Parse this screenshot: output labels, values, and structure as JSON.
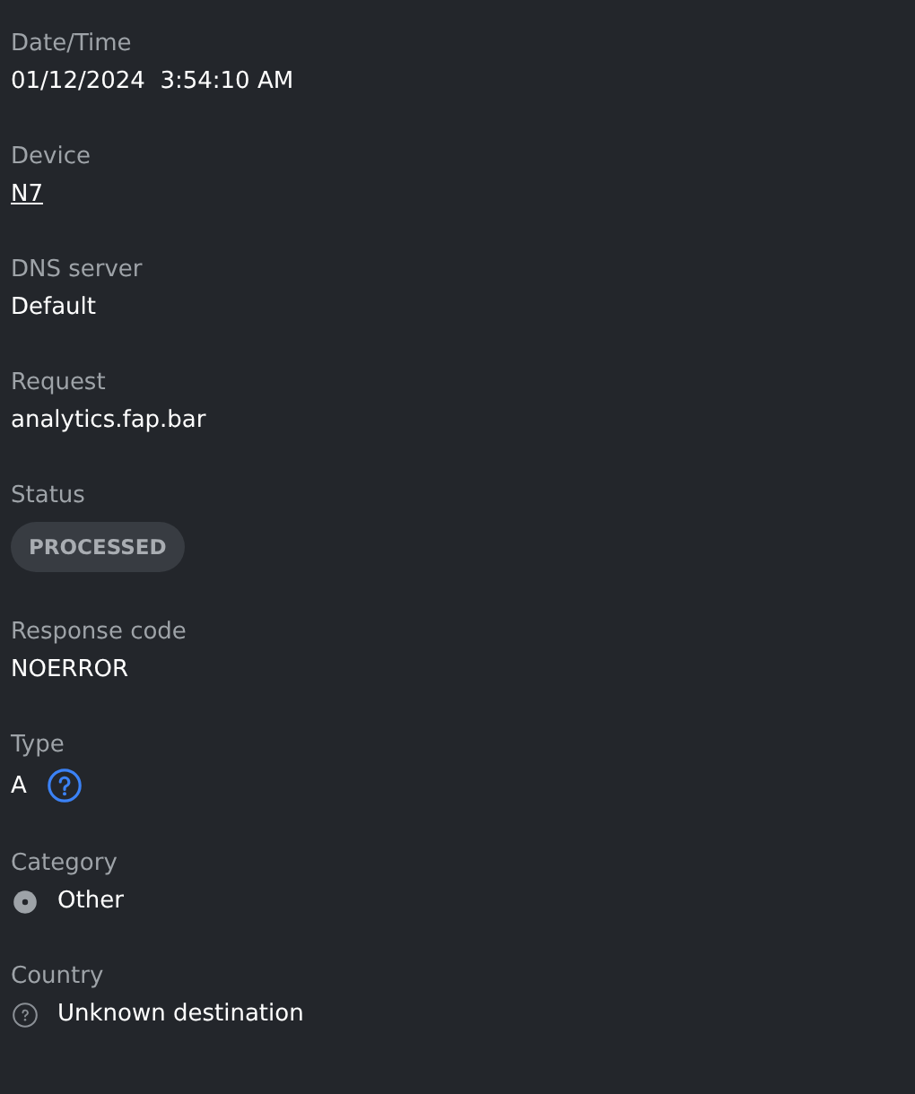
{
  "fields": [
    {
      "label": "Date/Time",
      "kind": "text",
      "value": "01/12/2024  3:54:10 AM"
    },
    {
      "label": "Device",
      "kind": "link",
      "value": "N7"
    },
    {
      "label": "DNS server",
      "kind": "text",
      "value": "Default"
    },
    {
      "label": "Request",
      "kind": "text",
      "value": "analytics.fap.bar"
    },
    {
      "label": "Status",
      "kind": "badge",
      "value": "PROCESSED"
    },
    {
      "label": "Response code",
      "kind": "text",
      "value": "NOERROR"
    },
    {
      "label": "Type",
      "kind": "help",
      "value": "A"
    },
    {
      "label": "Category",
      "kind": "category",
      "value": "Other"
    },
    {
      "label": "Country",
      "kind": "country",
      "value": "Unknown destination"
    }
  ]
}
